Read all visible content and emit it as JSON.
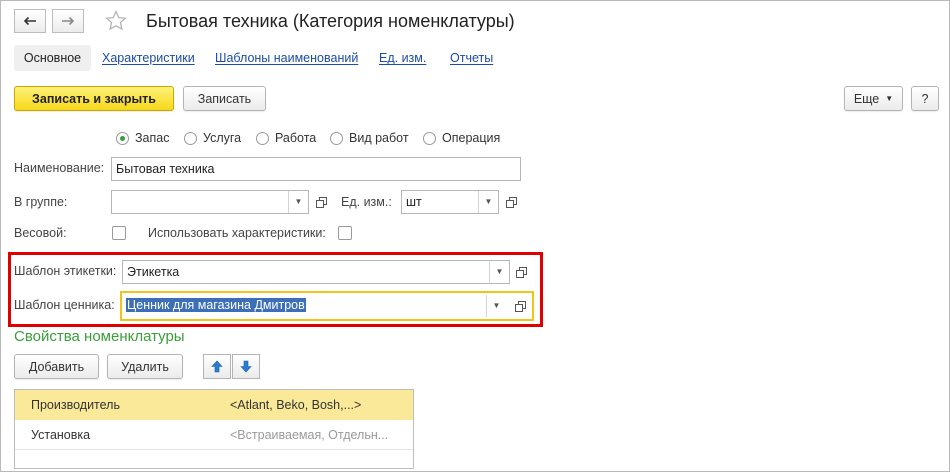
{
  "window": {
    "title": "Бытовая техника (Категория номенклатуры)"
  },
  "tabs": [
    {
      "label": "Основное"
    },
    {
      "label": "Характеристики"
    },
    {
      "label": "Шаблоны наименований"
    },
    {
      "label": "Ед. изм."
    },
    {
      "label": "Отчеты"
    }
  ],
  "toolbar": {
    "save_close_label": "Записать и закрыть",
    "save_label": "Записать",
    "more_label": "Еще",
    "help_label": "?"
  },
  "type_options": [
    {
      "label": "Запас",
      "selected": true
    },
    {
      "label": "Услуга",
      "selected": false
    },
    {
      "label": "Работа",
      "selected": false
    },
    {
      "label": "Вид работ",
      "selected": false
    },
    {
      "label": "Операция",
      "selected": false
    }
  ],
  "form": {
    "name_label": "Наименование:",
    "name_value": "Бытовая техника",
    "group_label": "В группе:",
    "group_value": "",
    "unit_label": "Ед. изм.:",
    "unit_value": "шт",
    "weight_label": "Весовой:",
    "weight_checked": false,
    "use_chars_label": "Использовать характеристики:",
    "use_chars_checked": false,
    "label_template_label": "Шаблон этикетки:",
    "label_template_value": "Этикетка",
    "price_tag_label": "Шаблон ценника:",
    "price_tag_value": "Ценник для магазина Дмитров"
  },
  "properties": {
    "section_title": "Свойства номенклатуры",
    "add_label": "Добавить",
    "delete_label": "Удалить",
    "rows": [
      {
        "name": "Производитель",
        "value": "<Atlant, Beko, Bosh,...>"
      },
      {
        "name": "Установка",
        "value": "<Встраиваемая, Отдельн..."
      }
    ]
  },
  "colors": {
    "accent_yellow": "#f7d81a",
    "section_green": "#3a9e3a",
    "highlight_red": "#e00000",
    "selected_row": "#fbe99a",
    "link_blue": "#1c4ca3"
  }
}
